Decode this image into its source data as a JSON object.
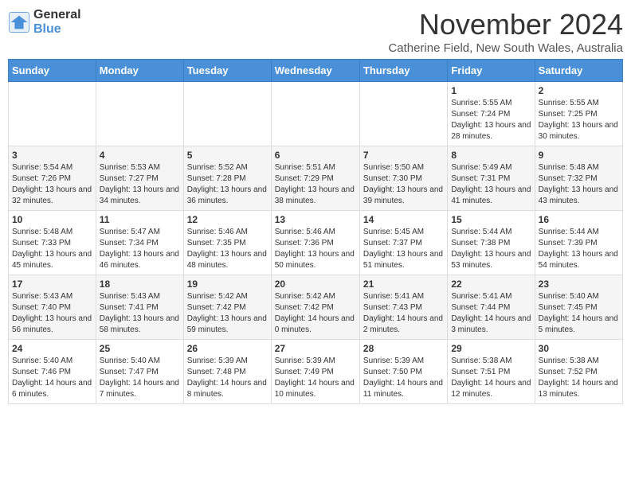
{
  "header": {
    "logo_line1": "General",
    "logo_line2": "Blue",
    "title": "November 2024",
    "subtitle": "Catherine Field, New South Wales, Australia"
  },
  "calendar": {
    "days_of_week": [
      "Sunday",
      "Monday",
      "Tuesday",
      "Wednesday",
      "Thursday",
      "Friday",
      "Saturday"
    ],
    "weeks": [
      [
        {
          "day": "",
          "info": ""
        },
        {
          "day": "",
          "info": ""
        },
        {
          "day": "",
          "info": ""
        },
        {
          "day": "",
          "info": ""
        },
        {
          "day": "",
          "info": ""
        },
        {
          "day": "1",
          "info": "Sunrise: 5:55 AM\nSunset: 7:24 PM\nDaylight: 13 hours and 28 minutes."
        },
        {
          "day": "2",
          "info": "Sunrise: 5:55 AM\nSunset: 7:25 PM\nDaylight: 13 hours and 30 minutes."
        }
      ],
      [
        {
          "day": "3",
          "info": "Sunrise: 5:54 AM\nSunset: 7:26 PM\nDaylight: 13 hours and 32 minutes."
        },
        {
          "day": "4",
          "info": "Sunrise: 5:53 AM\nSunset: 7:27 PM\nDaylight: 13 hours and 34 minutes."
        },
        {
          "day": "5",
          "info": "Sunrise: 5:52 AM\nSunset: 7:28 PM\nDaylight: 13 hours and 36 minutes."
        },
        {
          "day": "6",
          "info": "Sunrise: 5:51 AM\nSunset: 7:29 PM\nDaylight: 13 hours and 38 minutes."
        },
        {
          "day": "7",
          "info": "Sunrise: 5:50 AM\nSunset: 7:30 PM\nDaylight: 13 hours and 39 minutes."
        },
        {
          "day": "8",
          "info": "Sunrise: 5:49 AM\nSunset: 7:31 PM\nDaylight: 13 hours and 41 minutes."
        },
        {
          "day": "9",
          "info": "Sunrise: 5:48 AM\nSunset: 7:32 PM\nDaylight: 13 hours and 43 minutes."
        }
      ],
      [
        {
          "day": "10",
          "info": "Sunrise: 5:48 AM\nSunset: 7:33 PM\nDaylight: 13 hours and 45 minutes."
        },
        {
          "day": "11",
          "info": "Sunrise: 5:47 AM\nSunset: 7:34 PM\nDaylight: 13 hours and 46 minutes."
        },
        {
          "day": "12",
          "info": "Sunrise: 5:46 AM\nSunset: 7:35 PM\nDaylight: 13 hours and 48 minutes."
        },
        {
          "day": "13",
          "info": "Sunrise: 5:46 AM\nSunset: 7:36 PM\nDaylight: 13 hours and 50 minutes."
        },
        {
          "day": "14",
          "info": "Sunrise: 5:45 AM\nSunset: 7:37 PM\nDaylight: 13 hours and 51 minutes."
        },
        {
          "day": "15",
          "info": "Sunrise: 5:44 AM\nSunset: 7:38 PM\nDaylight: 13 hours and 53 minutes."
        },
        {
          "day": "16",
          "info": "Sunrise: 5:44 AM\nSunset: 7:39 PM\nDaylight: 13 hours and 54 minutes."
        }
      ],
      [
        {
          "day": "17",
          "info": "Sunrise: 5:43 AM\nSunset: 7:40 PM\nDaylight: 13 hours and 56 minutes."
        },
        {
          "day": "18",
          "info": "Sunrise: 5:43 AM\nSunset: 7:41 PM\nDaylight: 13 hours and 58 minutes."
        },
        {
          "day": "19",
          "info": "Sunrise: 5:42 AM\nSunset: 7:42 PM\nDaylight: 13 hours and 59 minutes."
        },
        {
          "day": "20",
          "info": "Sunrise: 5:42 AM\nSunset: 7:42 PM\nDaylight: 14 hours and 0 minutes."
        },
        {
          "day": "21",
          "info": "Sunrise: 5:41 AM\nSunset: 7:43 PM\nDaylight: 14 hours and 2 minutes."
        },
        {
          "day": "22",
          "info": "Sunrise: 5:41 AM\nSunset: 7:44 PM\nDaylight: 14 hours and 3 minutes."
        },
        {
          "day": "23",
          "info": "Sunrise: 5:40 AM\nSunset: 7:45 PM\nDaylight: 14 hours and 5 minutes."
        }
      ],
      [
        {
          "day": "24",
          "info": "Sunrise: 5:40 AM\nSunset: 7:46 PM\nDaylight: 14 hours and 6 minutes."
        },
        {
          "day": "25",
          "info": "Sunrise: 5:40 AM\nSunset: 7:47 PM\nDaylight: 14 hours and 7 minutes."
        },
        {
          "day": "26",
          "info": "Sunrise: 5:39 AM\nSunset: 7:48 PM\nDaylight: 14 hours and 8 minutes."
        },
        {
          "day": "27",
          "info": "Sunrise: 5:39 AM\nSunset: 7:49 PM\nDaylight: 14 hours and 10 minutes."
        },
        {
          "day": "28",
          "info": "Sunrise: 5:39 AM\nSunset: 7:50 PM\nDaylight: 14 hours and 11 minutes."
        },
        {
          "day": "29",
          "info": "Sunrise: 5:38 AM\nSunset: 7:51 PM\nDaylight: 14 hours and 12 minutes."
        },
        {
          "day": "30",
          "info": "Sunrise: 5:38 AM\nSunset: 7:52 PM\nDaylight: 14 hours and 13 minutes."
        }
      ]
    ]
  }
}
